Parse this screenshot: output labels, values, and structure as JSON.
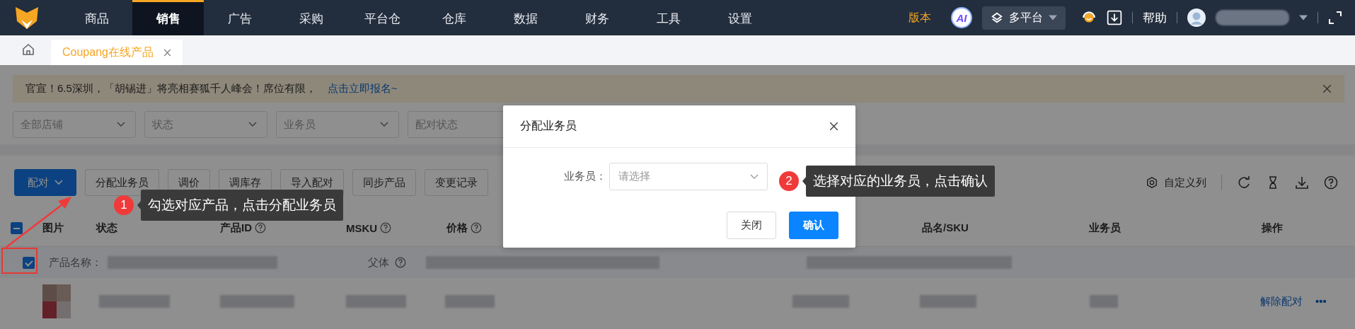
{
  "nav": {
    "items": [
      {
        "label": "商品",
        "selected": false
      },
      {
        "label": "销售",
        "selected": true
      },
      {
        "label": "广告",
        "selected": false
      },
      {
        "label": "采购",
        "selected": false
      },
      {
        "label": "平台仓",
        "selected": false
      },
      {
        "label": "仓库",
        "selected": false
      },
      {
        "label": "数据",
        "selected": false
      },
      {
        "label": "财务",
        "selected": false
      },
      {
        "label": "工具",
        "selected": false
      },
      {
        "label": "设置",
        "selected": false
      }
    ],
    "version": "版本",
    "ai": "AI",
    "platform": "多平台",
    "help": "帮助"
  },
  "tabs": [
    {
      "label": "Coupang在线产品",
      "selected": true
    }
  ],
  "notice": {
    "text": "官宣！6.5深圳，「胡锡进」将亮相赛狐千人峰会！席位有限，",
    "link": "点击立即报名~"
  },
  "filters": [
    {
      "placeholder": "全部店铺"
    },
    {
      "placeholder": "状态"
    },
    {
      "placeholder": "业务员"
    },
    {
      "placeholder": "配对状态"
    }
  ],
  "toolbar": {
    "buttons": [
      {
        "label": "配对",
        "kind": "primary"
      },
      {
        "label": "分配业务员",
        "kind": "default"
      },
      {
        "label": "调价",
        "kind": "default"
      },
      {
        "label": "调库存",
        "kind": "default"
      },
      {
        "label": "导入配对",
        "kind": "default"
      },
      {
        "label": "同步产品",
        "kind": "default"
      },
      {
        "label": "变更记录",
        "kind": "default"
      }
    ],
    "columns_button": "自定义列"
  },
  "table": {
    "header_indeterminate": true,
    "columns": [
      {
        "label": "图片",
        "help": false
      },
      {
        "label": "状态",
        "help": false
      },
      {
        "label": "产品ID",
        "help": true
      },
      {
        "label": "MSKU",
        "help": true
      },
      {
        "label": "价格",
        "help": true
      },
      {
        "label": "品名/SKU",
        "help": false
      },
      {
        "label": "业务员",
        "help": false
      },
      {
        "label": "操作",
        "help": false
      }
    ],
    "rows": [
      {
        "checked": true,
        "name_label": "产品名称：",
        "parent_label": "父体",
        "action": "解除配对",
        "more": "•••"
      }
    ]
  },
  "modal": {
    "title": "分配业务员",
    "field_label": "业务员：",
    "placeholder": "请选择",
    "buttons": [
      {
        "label": "关闭",
        "kind": "default"
      },
      {
        "label": "确认",
        "kind": "primary"
      }
    ]
  },
  "annotations": [
    {
      "number": "1",
      "text": "勾选对应产品，点击分配业务员"
    },
    {
      "number": "2",
      "text": "选择对应的业务员，点击确认"
    }
  ]
}
